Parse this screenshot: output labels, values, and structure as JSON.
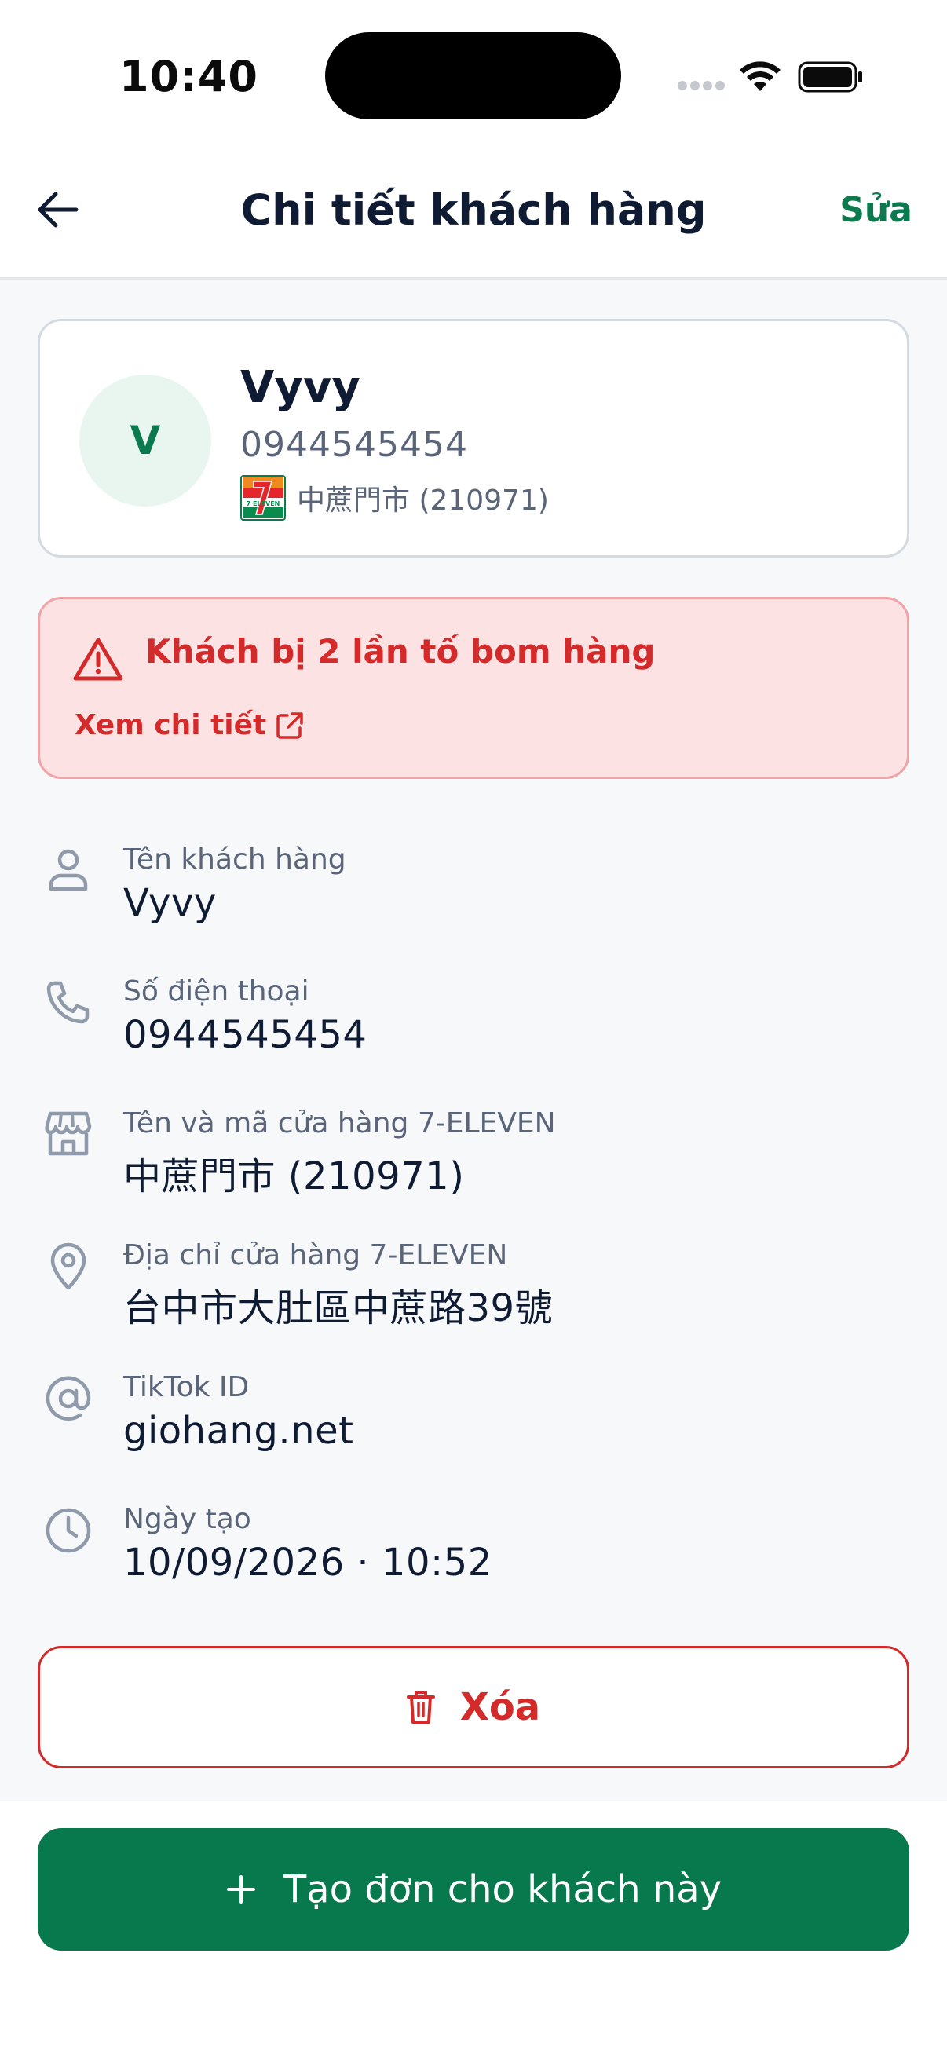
{
  "status_bar": {
    "time": "10:40"
  },
  "header": {
    "title": "Chi tiết khách hàng",
    "edit_label": "Sửa"
  },
  "customer_card": {
    "avatar_initial": "V",
    "name": "Vyvy",
    "phone": "0944545454",
    "store": "中蔗門市 (210971)",
    "store_logo_text": "7 ELEVEN"
  },
  "alert": {
    "title": "Khách bị 2 lần tố bom hàng",
    "link_label": "Xem chi tiết"
  },
  "details": [
    {
      "icon": "person-icon",
      "label": "Tên khách hàng",
      "value": "Vyvy"
    },
    {
      "icon": "phone-icon",
      "label": "Số điện thoại",
      "value": "0944545454"
    },
    {
      "icon": "store-icon",
      "label": "Tên và mã cửa hàng 7-ELEVEN",
      "value": "中蔗門市 (210971)"
    },
    {
      "icon": "location-pin-icon",
      "label": "Địa chỉ cửa hàng 7-ELEVEN",
      "value": "台中市大肚區中蔗路39號"
    },
    {
      "icon": "at-sign-icon",
      "label": "TikTok ID",
      "value": "giohang.net"
    },
    {
      "icon": "clock-icon",
      "label": "Ngày tạo",
      "value": "10/09/2026 · 10:52"
    }
  ],
  "actions": {
    "delete_label": "Xóa",
    "create_order_label": "Tạo đơn cho khách này"
  },
  "colors": {
    "brand_green": "#08784d",
    "danger_red": "#d42a2a",
    "alert_background": "#fde2e4",
    "page_background": "#f6f8fa"
  }
}
